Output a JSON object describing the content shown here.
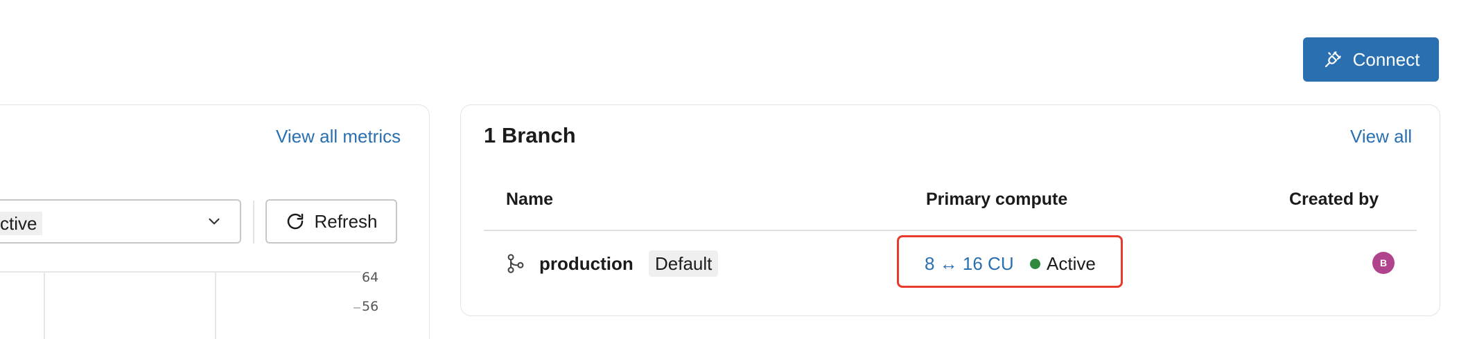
{
  "header": {
    "connect_label": "Connect"
  },
  "metrics_card": {
    "view_all_label": "View all metrics",
    "select_value": "ctive",
    "refresh_label": "Refresh",
    "y_ticks": [
      "64",
      "56"
    ]
  },
  "branches_card": {
    "title": "1 Branch",
    "view_all_label": "View all",
    "columns": [
      "Name",
      "Primary compute",
      "Created by"
    ],
    "rows": [
      {
        "name": "production",
        "tag": "Default",
        "compute": "8 ↔ 16 CU",
        "status": "Active",
        "created_by_initial": "B"
      }
    ]
  },
  "colors": {
    "accent": "#2a6fb0",
    "status_active": "#2f8a3e",
    "avatar": "#b0448c",
    "highlight": "#e8392c"
  },
  "icons": {
    "connect": "plug-icon",
    "refresh": "refresh-icon",
    "chevron": "chevron-down-icon",
    "branch": "git-branch-icon"
  }
}
